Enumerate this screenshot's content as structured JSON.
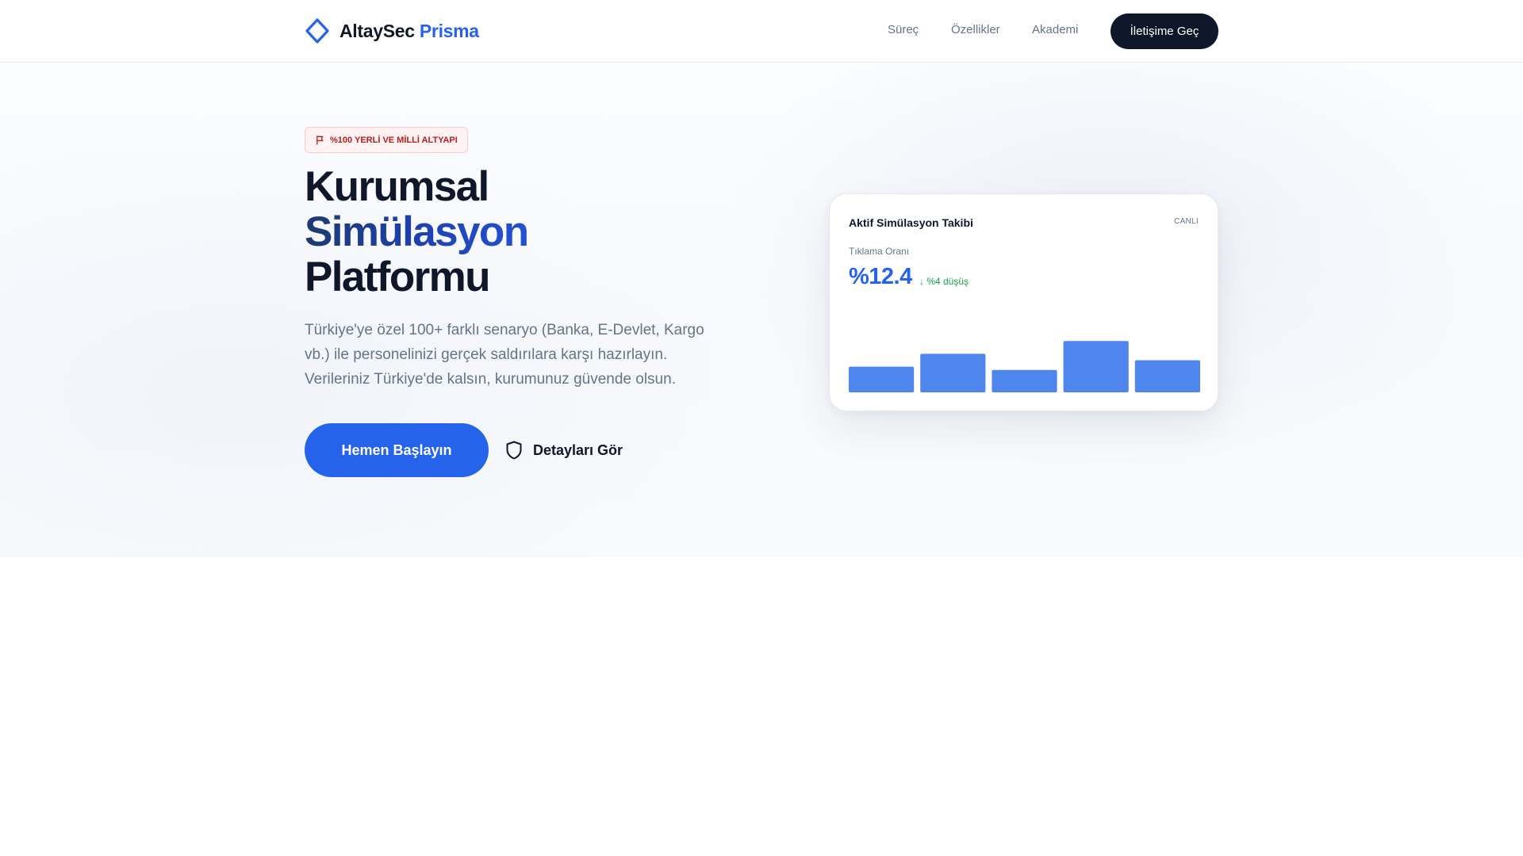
{
  "header": {
    "brand": "AltaySec",
    "brand_accent": "Prisma",
    "nav": [
      "Süreç",
      "Özellikler",
      "Akademi"
    ],
    "cta": "İletişime Geç"
  },
  "hero": {
    "badge": "%100 YERLİ VE MİLLİ ALTYAPI",
    "title_line1": "Kurumsal",
    "title_line2": "Simülasyon",
    "title_line3": "Platformu",
    "description": "Türkiye'ye özel 100+ farklı senaryo (Banka, E-Devlet, Kargo vb.) ile personelinizi gerçek saldırılara karşı hazırlayın. Verileriniz Türkiye'de kalsın, kurumunuz güvende olsun.",
    "primary_button": "Hemen Başlayın",
    "secondary_button": "Detayları Gör"
  },
  "card": {
    "title": "Aktif Simülasyon Takibi",
    "live": "CANLI",
    "metric_label": "Tıklama Oranı",
    "metric_value": "%12.4",
    "metric_delta": "↓ %4 düşüş"
  },
  "chart_data": {
    "type": "bar",
    "values": [
      40,
      60,
      35,
      80,
      50
    ],
    "ylim": [
      0,
      100
    ],
    "color": "#4f86ee"
  },
  "colors": {
    "accent": "#2563eb",
    "dark": "#0f172a",
    "badge_red": "#b91c1c",
    "success": "#16a34a"
  },
  "icons": {
    "logo": "diamond-outline-icon",
    "badge": "flag-icon",
    "secondary_button": "shield-icon"
  }
}
